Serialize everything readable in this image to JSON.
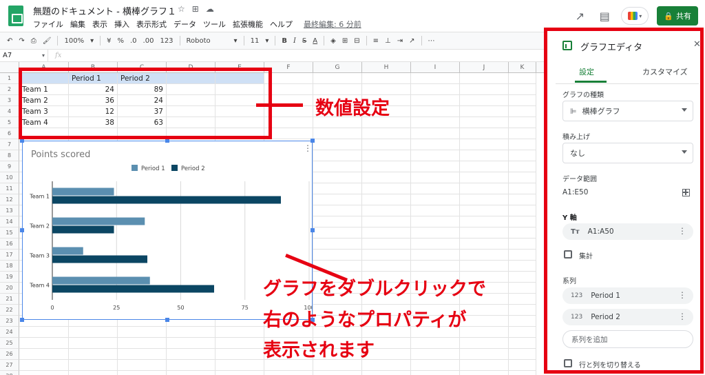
{
  "app": {
    "doc_title": "無題のドキュメント - 横棒グラフ１",
    "menus": [
      "ファイル",
      "編集",
      "表示",
      "挿入",
      "表示形式",
      "データ",
      "ツール",
      "拡張機能",
      "ヘルプ"
    ],
    "last_edit": "最終編集: 6 分前",
    "share_label": "共有"
  },
  "toolbar": {
    "zoom": "100%",
    "currency": "¥",
    "percent": "%",
    "dec_less": ".0",
    "dec_more": ".00",
    "format_more": "123",
    "font": "Roboto",
    "font_size": "11",
    "bold": "B",
    "italic": "I",
    "strike": "S",
    "text_color": "A"
  },
  "formula_bar": {
    "cell_ref": "A7",
    "fx": "fx"
  },
  "sheet": {
    "columns": [
      "A",
      "B",
      "C",
      "D",
      "E",
      "F",
      "G",
      "H",
      "I",
      "J",
      "K"
    ],
    "rows": [
      "1",
      "2",
      "3",
      "4",
      "5",
      "6",
      "7",
      "8",
      "9",
      "10",
      "11",
      "12",
      "13",
      "14",
      "15",
      "16",
      "17",
      "18",
      "19",
      "20",
      "21",
      "22",
      "23",
      "24",
      "25",
      "26",
      "27",
      "28"
    ],
    "header": [
      "",
      "Period 1",
      "Period 2"
    ],
    "data": [
      [
        "Team 1",
        "24",
        "89"
      ],
      [
        "Team 2",
        "36",
        "24"
      ],
      [
        "Team 3",
        "12",
        "37"
      ],
      [
        "Team 4",
        "38",
        "63"
      ]
    ]
  },
  "chart_data": {
    "type": "bar",
    "orientation": "horizontal",
    "title": "Points scored",
    "categories": [
      "Team 1",
      "Team 2",
      "Team 3",
      "Team 4"
    ],
    "series": [
      {
        "name": "Period 1",
        "values": [
          24,
          36,
          12,
          38
        ],
        "color": "#5b8fb0"
      },
      {
        "name": "Period 2",
        "values": [
          89,
          24,
          37,
          63
        ],
        "color": "#0b4663"
      }
    ],
    "xlim": [
      0,
      100
    ],
    "x_ticks": [
      "0",
      "25",
      "50",
      "75",
      "100"
    ],
    "grid": true,
    "legend": "top"
  },
  "annotations": {
    "numeric_setting": "数値設定",
    "note_line1": "グラフをダブルクリックで",
    "note_line2": "右のようなプロパティが",
    "note_line3": "表示されます",
    "color": "#e60012"
  },
  "panel": {
    "title": "グラフエディタ",
    "tab_setup": "設定",
    "tab_customize": "カスタマイズ",
    "chart_type_label": "グラフの種類",
    "chart_type_value": "横棒グラフ",
    "stacking_label": "積み上げ",
    "stacking_value": "なし",
    "data_range_label": "データ範囲",
    "data_range_value": "A1:E50",
    "y_axis_label": "Y 軸",
    "y_axis_value": "A1:A50",
    "y_axis_icon": "Tт",
    "aggregate_label": "集計",
    "series_label": "系列",
    "series": [
      {
        "icon": "123",
        "name": "Period 1"
      },
      {
        "icon": "123",
        "name": "Period 2"
      }
    ],
    "add_series": "系列を追加",
    "switch_rows_cols": "行と列を切り替える"
  }
}
